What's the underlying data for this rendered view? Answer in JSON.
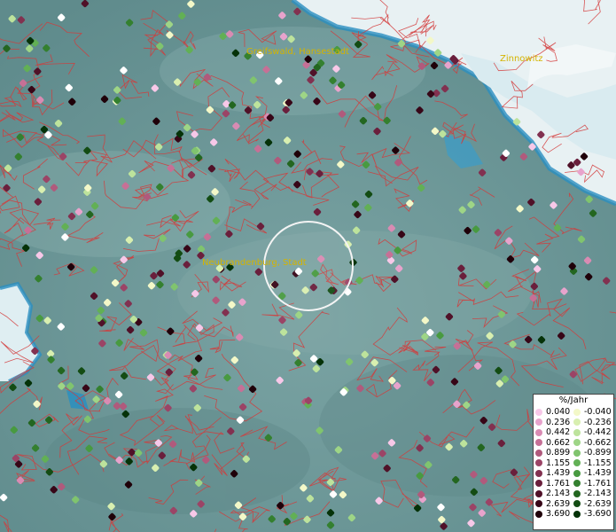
{
  "map": {
    "cities": [
      {
        "name": "Greifswald, Hansestadt"
      },
      {
        "name": "Zinnowitz"
      },
      {
        "name": "Neubrandenburg, Stadt"
      }
    ]
  },
  "legend": {
    "title": "%/Jahr",
    "rows": [
      {
        "pos": "0.040",
        "pos_color": "#f7c8e8",
        "neg": "-0.040",
        "neg_color": "#f3f8c8"
      },
      {
        "pos": "0.236",
        "pos_color": "#e8a3cc",
        "neg": "-0.236",
        "neg_color": "#d8efb0"
      },
      {
        "pos": "0.442",
        "pos_color": "#d98bb3",
        "neg": "-0.442",
        "neg_color": "#bde39c"
      },
      {
        "pos": "0.662",
        "pos_color": "#c67096",
        "neg": "-0.662",
        "neg_color": "#9ed586"
      },
      {
        "pos": "0.899",
        "pos_color": "#b05a7c",
        "neg": "-0.899",
        "neg_color": "#80c46e"
      },
      {
        "pos": "1.155",
        "pos_color": "#9b4466",
        "neg": "-1.155",
        "neg_color": "#62b055"
      },
      {
        "pos": "1.439",
        "pos_color": "#823150",
        "neg": "-1.439",
        "neg_color": "#489a40"
      },
      {
        "pos": "1.761",
        "pos_color": "#6a1f3c",
        "neg": "-1.761",
        "neg_color": "#34802f"
      },
      {
        "pos": "2.143",
        "pos_color": "#501128",
        "neg": "-2.143",
        "neg_color": "#236620"
      },
      {
        "pos": "2.639",
        "pos_color": "#370617",
        "neg": "-2.639",
        "neg_color": "#134c13"
      },
      {
        "pos": "3.690",
        "pos_color": "#1f0009",
        "neg": "-3.690",
        "neg_color": "#053208"
      }
    ]
  }
}
